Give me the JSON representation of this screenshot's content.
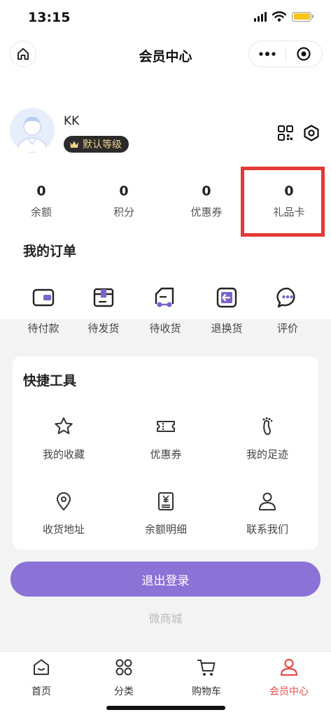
{
  "status_bar": {
    "time": "13:15",
    "battery_level": 0.9,
    "battery_color": "#f5c518",
    "icons": [
      "signal-icon",
      "wifi-icon",
      "battery-icon"
    ]
  },
  "nav": {
    "title": "会员中心",
    "icons": [
      "home-icon",
      "more-icon",
      "close-target-icon"
    ]
  },
  "profile": {
    "username": "KK",
    "level": "默认等级",
    "icons": [
      "avatar",
      "crown-icon",
      "qrcode-icon",
      "settings-icon"
    ]
  },
  "stats": [
    {
      "value": "0",
      "label": "余额"
    },
    {
      "value": "0",
      "label": "积分"
    },
    {
      "value": "0",
      "label": "优惠券"
    },
    {
      "value": "0",
      "label": "礼品卡"
    }
  ],
  "orders": {
    "title": "我的订单",
    "items": [
      {
        "label": "待付款",
        "icon": "wallet-icon"
      },
      {
        "label": "待发货",
        "icon": "package-icon"
      },
      {
        "label": "待收货",
        "icon": "truck-icon"
      },
      {
        "label": "退换货",
        "icon": "return-icon"
      },
      {
        "label": "评价",
        "icon": "comment-icon"
      }
    ]
  },
  "tools": {
    "title": "快捷工具",
    "items": [
      {
        "label": "我的收藏",
        "icon": "star-icon"
      },
      {
        "label": "优惠券",
        "icon": "ticket-icon"
      },
      {
        "label": "我的足迹",
        "icon": "footprint-icon"
      },
      {
        "label": "收货地址",
        "icon": "location-icon"
      },
      {
        "label": "余额明细",
        "icon": "receipt-icon"
      },
      {
        "label": "联系我们",
        "icon": "person-icon"
      }
    ]
  },
  "logout_label": "退出登录",
  "footer": "微商城",
  "tabs": [
    {
      "label": "首页",
      "icon": "home-tab-icon"
    },
    {
      "label": "分类",
      "icon": "category-icon"
    },
    {
      "label": "购物车",
      "icon": "cart-icon"
    },
    {
      "label": "会员中心",
      "icon": "user-icon",
      "active": true
    }
  ],
  "colors": {
    "accent": "#8b72d6",
    "active_tab": "#e94b4b",
    "highlight_box": "#e53935",
    "order_icon_fill": "#7b63c9"
  }
}
